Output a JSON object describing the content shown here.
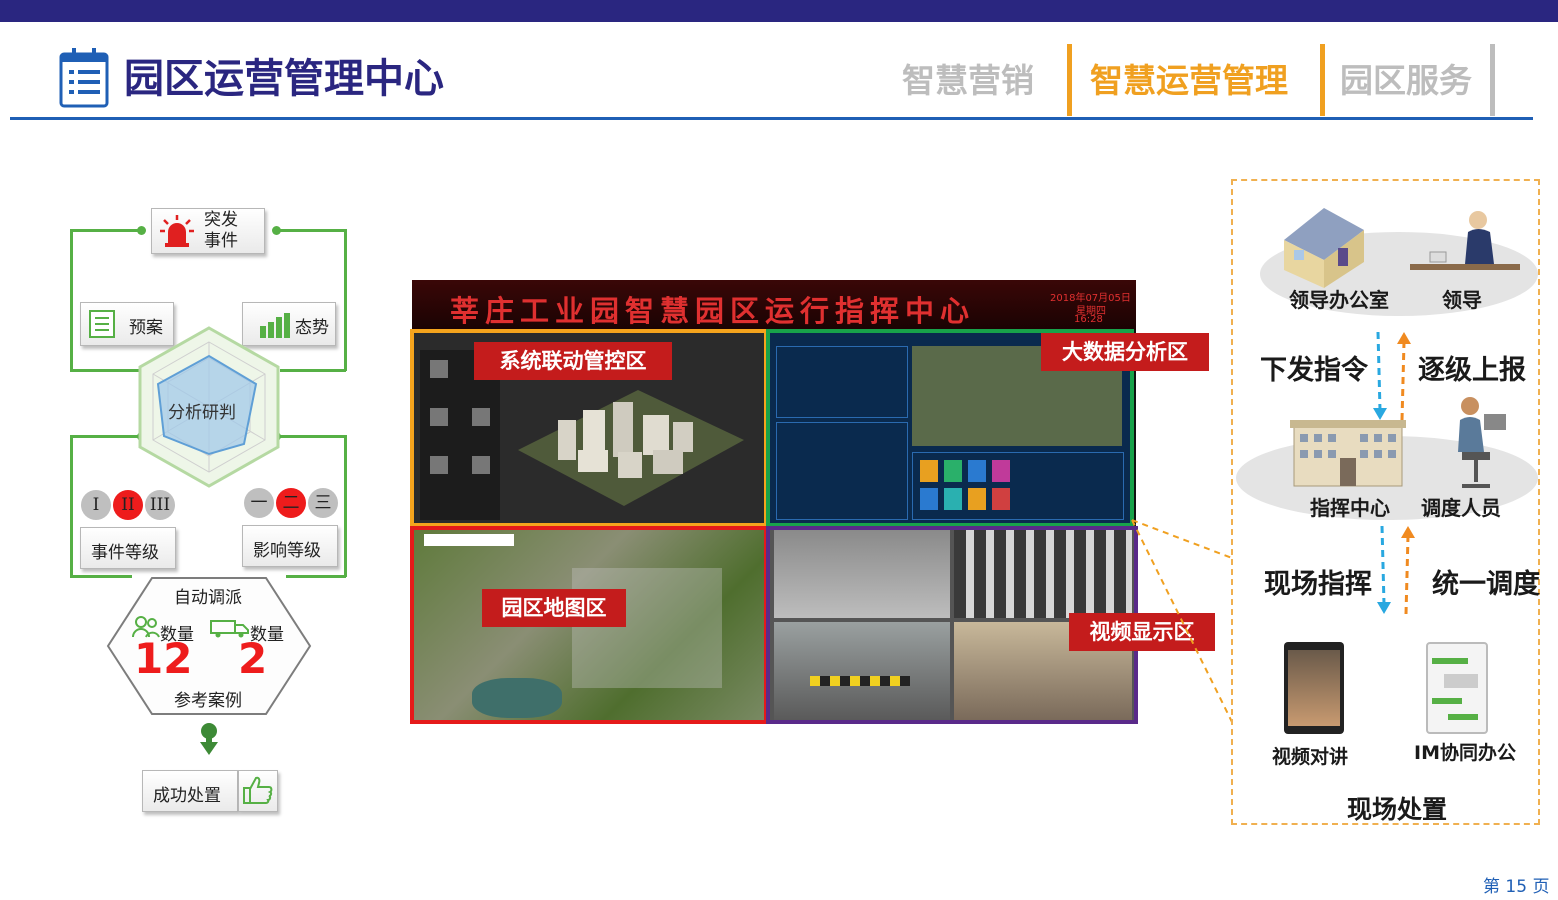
{
  "header": {
    "title": "园区运营管理中心",
    "nav": [
      {
        "label": "智慧营销",
        "active": false
      },
      {
        "label": "智慧运营管理",
        "active": true
      },
      {
        "label": "园区服务",
        "active": false
      }
    ]
  },
  "flow": {
    "emergency": "突发\n事件",
    "plan": "预案",
    "trend": "态势",
    "analysis": "分析研判",
    "event_levels": [
      "I",
      "II",
      "III"
    ],
    "event_grade": "事件等级",
    "impact_levels": [
      "一",
      "二",
      "三"
    ],
    "impact_grade": "影响等级",
    "auto_dispatch": "自动调派",
    "people_label": "数量",
    "people_count": "12",
    "vehicle_label": "数量",
    "vehicle_count": "2",
    "reference": "参考案例",
    "success": "成功处置"
  },
  "screen": {
    "banner_title": "莘庄工业园智慧园区运行指挥中心",
    "date": "2018年07月05日",
    "weekday": "星期四",
    "time": "16:28",
    "zones": {
      "linkage": "系统联动管控区",
      "bigdata": "大数据分析区",
      "map": "园区地图区",
      "video": "视频显示区"
    }
  },
  "command": {
    "leader_office": "领导办公室",
    "leader": "领导",
    "issue": "下发指令",
    "report": "逐级上报",
    "center": "指挥中心",
    "dispatcher": "调度人员",
    "onsite_command": "现场指挥",
    "unified": "统一调度",
    "video_call": "视频对讲",
    "im": "IM协同办公",
    "onsite": "现场处置"
  },
  "footer": {
    "page": "第 15 页"
  },
  "colors": {
    "brand": "#2a2680",
    "accent": "#f0a020",
    "flow_green": "#56b045",
    "label_red": "#c41c1c"
  }
}
